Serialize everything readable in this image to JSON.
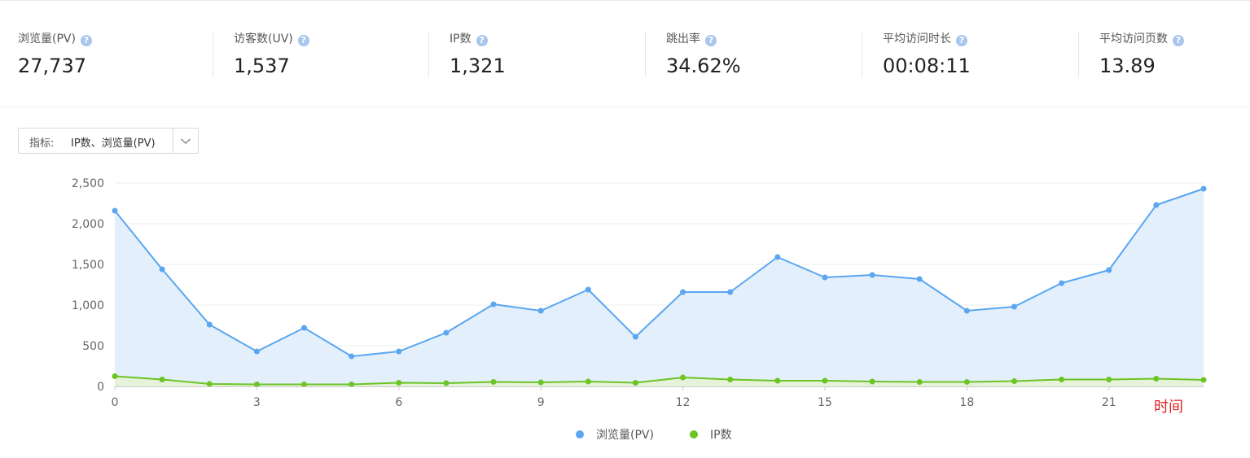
{
  "stats": [
    {
      "label": "浏览量(PV)",
      "value": "27,737"
    },
    {
      "label": "访客数(UV)",
      "value": "1,537"
    },
    {
      "label": "IP数",
      "value": "1,321"
    },
    {
      "label": "跳出率",
      "value": "34.62%"
    },
    {
      "label": "平均访问时长",
      "value": "00:08:11"
    },
    {
      "label": "平均访问页数",
      "value": "13.89"
    }
  ],
  "help_icon": {
    "name": "question-circle-icon",
    "glyph": "?",
    "color": "#a8c6ee"
  },
  "selector": {
    "label": "指标:",
    "value": "IP数、浏览量(PV)",
    "icon": "chevron-down-icon"
  },
  "chart_data": {
    "type": "area",
    "x": [
      0,
      1,
      2,
      3,
      4,
      5,
      6,
      7,
      8,
      9,
      10,
      11,
      12,
      13,
      14,
      15,
      16,
      17,
      18,
      19,
      20,
      21,
      22,
      23
    ],
    "x_ticks": [
      0,
      3,
      6,
      9,
      12,
      15,
      18,
      21
    ],
    "y_ticks": [
      "0",
      "500",
      "1,000",
      "1,500",
      "2,000",
      "2,500"
    ],
    "ylim": [
      0,
      2500
    ],
    "xlabel": "时间",
    "xlabel_color": "#e02020",
    "grid": true,
    "legend_position": "bottom-center",
    "series": [
      {
        "name": "浏览量(PV)",
        "color": "#5aa6f0",
        "fill": "#e3effb",
        "values": [
          2160,
          1440,
          760,
          430,
          720,
          370,
          430,
          660,
          1010,
          930,
          1190,
          610,
          1160,
          1160,
          1590,
          1340,
          1370,
          1320,
          930,
          980,
          1270,
          1430,
          2230,
          2430
        ]
      },
      {
        "name": "IP数",
        "color": "#6cc425",
        "fill": "#e6f2da",
        "values": [
          125,
          85,
          30,
          25,
          25,
          25,
          45,
          40,
          55,
          50,
          60,
          45,
          110,
          85,
          70,
          70,
          60,
          55,
          55,
          65,
          85,
          85,
          95,
          80
        ]
      }
    ]
  }
}
